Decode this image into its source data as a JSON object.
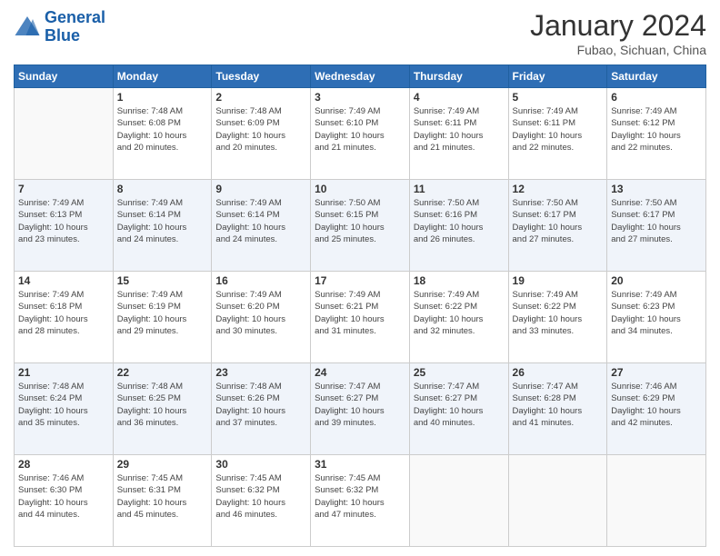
{
  "logo": {
    "line1": "General",
    "line2": "Blue"
  },
  "title": "January 2024",
  "subtitle": "Fubao, Sichuan, China",
  "weekdays": [
    "Sunday",
    "Monday",
    "Tuesday",
    "Wednesday",
    "Thursday",
    "Friday",
    "Saturday"
  ],
  "weeks": [
    [
      {
        "day": "",
        "info": ""
      },
      {
        "day": "1",
        "info": "Sunrise: 7:48 AM\nSunset: 6:08 PM\nDaylight: 10 hours\nand 20 minutes."
      },
      {
        "day": "2",
        "info": "Sunrise: 7:48 AM\nSunset: 6:09 PM\nDaylight: 10 hours\nand 20 minutes."
      },
      {
        "day": "3",
        "info": "Sunrise: 7:49 AM\nSunset: 6:10 PM\nDaylight: 10 hours\nand 21 minutes."
      },
      {
        "day": "4",
        "info": "Sunrise: 7:49 AM\nSunset: 6:11 PM\nDaylight: 10 hours\nand 21 minutes."
      },
      {
        "day": "5",
        "info": "Sunrise: 7:49 AM\nSunset: 6:11 PM\nDaylight: 10 hours\nand 22 minutes."
      },
      {
        "day": "6",
        "info": "Sunrise: 7:49 AM\nSunset: 6:12 PM\nDaylight: 10 hours\nand 22 minutes."
      }
    ],
    [
      {
        "day": "7",
        "info": "Sunrise: 7:49 AM\nSunset: 6:13 PM\nDaylight: 10 hours\nand 23 minutes."
      },
      {
        "day": "8",
        "info": "Sunrise: 7:49 AM\nSunset: 6:14 PM\nDaylight: 10 hours\nand 24 minutes."
      },
      {
        "day": "9",
        "info": "Sunrise: 7:49 AM\nSunset: 6:14 PM\nDaylight: 10 hours\nand 24 minutes."
      },
      {
        "day": "10",
        "info": "Sunrise: 7:50 AM\nSunset: 6:15 PM\nDaylight: 10 hours\nand 25 minutes."
      },
      {
        "day": "11",
        "info": "Sunrise: 7:50 AM\nSunset: 6:16 PM\nDaylight: 10 hours\nand 26 minutes."
      },
      {
        "day": "12",
        "info": "Sunrise: 7:50 AM\nSunset: 6:17 PM\nDaylight: 10 hours\nand 27 minutes."
      },
      {
        "day": "13",
        "info": "Sunrise: 7:50 AM\nSunset: 6:17 PM\nDaylight: 10 hours\nand 27 minutes."
      }
    ],
    [
      {
        "day": "14",
        "info": "Sunrise: 7:49 AM\nSunset: 6:18 PM\nDaylight: 10 hours\nand 28 minutes."
      },
      {
        "day": "15",
        "info": "Sunrise: 7:49 AM\nSunset: 6:19 PM\nDaylight: 10 hours\nand 29 minutes."
      },
      {
        "day": "16",
        "info": "Sunrise: 7:49 AM\nSunset: 6:20 PM\nDaylight: 10 hours\nand 30 minutes."
      },
      {
        "day": "17",
        "info": "Sunrise: 7:49 AM\nSunset: 6:21 PM\nDaylight: 10 hours\nand 31 minutes."
      },
      {
        "day": "18",
        "info": "Sunrise: 7:49 AM\nSunset: 6:22 PM\nDaylight: 10 hours\nand 32 minutes."
      },
      {
        "day": "19",
        "info": "Sunrise: 7:49 AM\nSunset: 6:22 PM\nDaylight: 10 hours\nand 33 minutes."
      },
      {
        "day": "20",
        "info": "Sunrise: 7:49 AM\nSunset: 6:23 PM\nDaylight: 10 hours\nand 34 minutes."
      }
    ],
    [
      {
        "day": "21",
        "info": "Sunrise: 7:48 AM\nSunset: 6:24 PM\nDaylight: 10 hours\nand 35 minutes."
      },
      {
        "day": "22",
        "info": "Sunrise: 7:48 AM\nSunset: 6:25 PM\nDaylight: 10 hours\nand 36 minutes."
      },
      {
        "day": "23",
        "info": "Sunrise: 7:48 AM\nSunset: 6:26 PM\nDaylight: 10 hours\nand 37 minutes."
      },
      {
        "day": "24",
        "info": "Sunrise: 7:47 AM\nSunset: 6:27 PM\nDaylight: 10 hours\nand 39 minutes."
      },
      {
        "day": "25",
        "info": "Sunrise: 7:47 AM\nSunset: 6:27 PM\nDaylight: 10 hours\nand 40 minutes."
      },
      {
        "day": "26",
        "info": "Sunrise: 7:47 AM\nSunset: 6:28 PM\nDaylight: 10 hours\nand 41 minutes."
      },
      {
        "day": "27",
        "info": "Sunrise: 7:46 AM\nSunset: 6:29 PM\nDaylight: 10 hours\nand 42 minutes."
      }
    ],
    [
      {
        "day": "28",
        "info": "Sunrise: 7:46 AM\nSunset: 6:30 PM\nDaylight: 10 hours\nand 44 minutes."
      },
      {
        "day": "29",
        "info": "Sunrise: 7:45 AM\nSunset: 6:31 PM\nDaylight: 10 hours\nand 45 minutes."
      },
      {
        "day": "30",
        "info": "Sunrise: 7:45 AM\nSunset: 6:32 PM\nDaylight: 10 hours\nand 46 minutes."
      },
      {
        "day": "31",
        "info": "Sunrise: 7:45 AM\nSunset: 6:32 PM\nDaylight: 10 hours\nand 47 minutes."
      },
      {
        "day": "",
        "info": ""
      },
      {
        "day": "",
        "info": ""
      },
      {
        "day": "",
        "info": ""
      }
    ]
  ]
}
